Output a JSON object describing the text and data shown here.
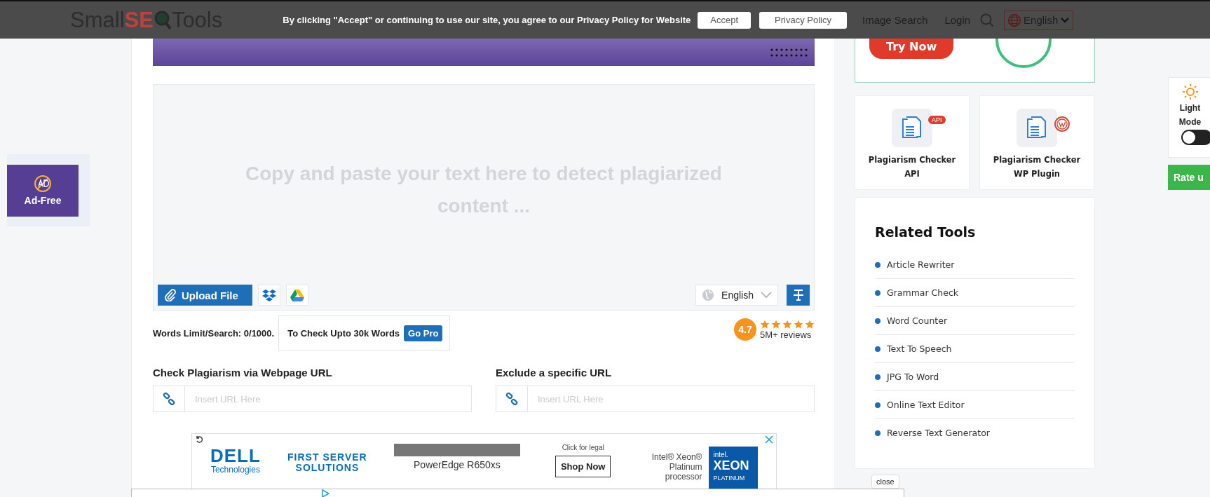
{
  "cookie_banner": {
    "message": "By clicking \"Accept\" or continuing to use our site, you agree to our Privacy Policy for Website",
    "buttons": [
      "Accept",
      "Privacy Policy"
    ]
  },
  "header": {
    "logo": {
      "part_1": "Small",
      "part_2": "SE",
      "part_3": "Tools"
    },
    "nav": [
      "Image Search",
      "Login"
    ],
    "language": "English"
  },
  "ad_free": {
    "label": "Ad-Free"
  },
  "editor": {
    "placeholder": "Copy and paste your text here to detect plagiarized content ...",
    "upload_button": "Upload File",
    "language": "English"
  },
  "limits": {
    "words_limit": "Words Limit/Search: 0/1000.",
    "upgrade_text": "To Check Upto 30k Words",
    "go_pro": "Go Pro"
  },
  "rating": {
    "score": "4.7",
    "stars": 5,
    "reviews": "5M+ reviews"
  },
  "url_fields": [
    {
      "label": "Check Plagiarism via Webpage URL",
      "placeholder": "Insert URL Here"
    },
    {
      "label": "Exclude a specific URL",
      "placeholder": "Insert URL Here"
    }
  ],
  "ad": {
    "brand": "DELL",
    "brand_sub": "Technologies",
    "headline": "FIRST SERVER SOLUTIONS",
    "product": "PowerEdge R650xs",
    "legal": "Click for legal",
    "shop_button": "Shop Now",
    "processor": "Intel® Xeon® Platinum processor",
    "chip_brand": "intel.",
    "chip_name": "XEON",
    "chip_tier": "PLATINUM"
  },
  "promo_card": {
    "button": "Try Now"
  },
  "tool_cards": [
    {
      "kind": "api",
      "title": "Plagiarism Checker API",
      "badge": "API"
    },
    {
      "kind": "wordpress",
      "title": "Plagiarism Checker WP Plugin"
    }
  ],
  "related_tools": {
    "title": "Related Tools",
    "items": [
      "Article Rewriter",
      "Grammar Check",
      "Word Counter",
      "Text To Speech",
      "JPG To Word",
      "Online Text Editor",
      "Reverse Text Generator"
    ]
  },
  "theme_toggle": {
    "label": "Light Mode",
    "on": false
  },
  "rate_button": "Rate u",
  "close_button": "close"
}
